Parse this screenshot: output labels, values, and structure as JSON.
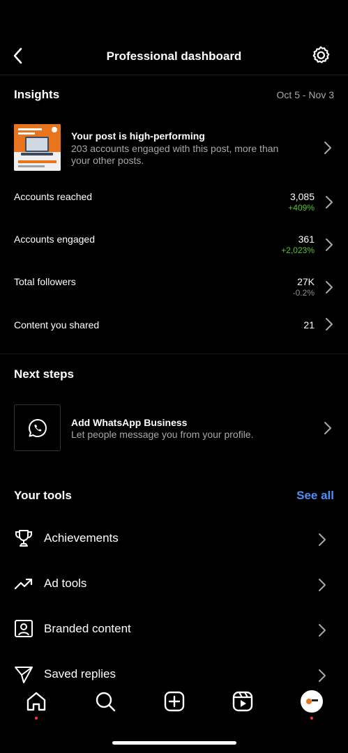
{
  "header": {
    "title": "Professional dashboard",
    "back_icon": "chevron-left-icon",
    "settings_icon": "gear-icon"
  },
  "insights": {
    "title": "Insights",
    "date_range": "Oct 5 - Nov 3",
    "highlight": {
      "title": "Your post is high-performing",
      "description_line1": "203 accounts engaged with this post, more than",
      "description_line2": "your other posts."
    },
    "metrics": [
      {
        "label": "Accounts reached",
        "value": "3,085",
        "change": "+409%",
        "trend": "up"
      },
      {
        "label": "Accounts engaged",
        "value": "361",
        "change": "+2,023%",
        "trend": "up"
      },
      {
        "label": "Total followers",
        "value": "27K",
        "change": "-0.2%",
        "trend": "down"
      },
      {
        "label": "Content you shared",
        "value": "21",
        "change": "",
        "trend": ""
      }
    ]
  },
  "next_steps": {
    "title": "Next steps",
    "item": {
      "title": "Add WhatsApp Business",
      "description": "Let people message you from your profile.",
      "icon": "whatsapp-icon"
    }
  },
  "tools": {
    "title": "Your tools",
    "see_all": "See all",
    "items": [
      {
        "label": "Achievements",
        "icon": "trophy-icon"
      },
      {
        "label": "Ad tools",
        "icon": "trending-up-icon"
      },
      {
        "label": "Branded content",
        "icon": "person-badge-icon"
      },
      {
        "label": "Saved replies",
        "icon": "send-icon"
      }
    ]
  },
  "tabbar": {
    "items": [
      "home-icon",
      "search-icon",
      "create-icon",
      "reels-icon",
      "profile-avatar"
    ]
  },
  "colors": {
    "background": "#000000",
    "accent": "#4a90f5",
    "positive": "#58c322",
    "muted": "#a8a8a8",
    "notification": "#ff3040"
  }
}
